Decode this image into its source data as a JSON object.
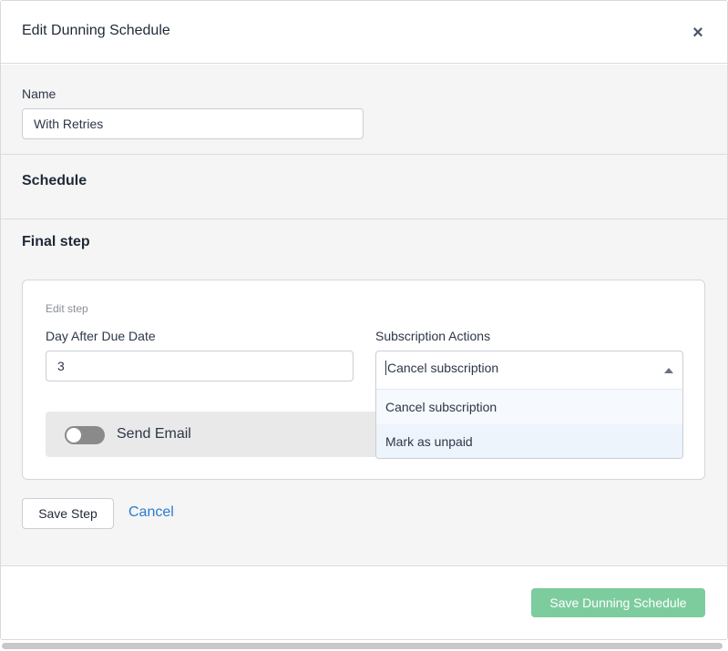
{
  "header": {
    "title": "Edit Dunning Schedule",
    "close_symbol": "×"
  },
  "name": {
    "label": "Name",
    "value": "With Retries"
  },
  "sections": {
    "schedule": "Schedule",
    "final_step": "Final step"
  },
  "step_card": {
    "caption": "Edit step",
    "day_label": "Day After Due Date",
    "day_value": "3",
    "actions_label": "Subscription Actions",
    "actions_selected": "Cancel subscription",
    "actions_options": [
      "Cancel subscription",
      "Mark as unpaid"
    ],
    "send_email_label": "Send Email",
    "send_email_enabled": false
  },
  "buttons": {
    "save_step": "Save Step",
    "cancel": "Cancel",
    "save_schedule": "Save Dunning Schedule"
  },
  "colors": {
    "primary_disabled": "#7dcc9e",
    "link": "#2b7bd1"
  }
}
